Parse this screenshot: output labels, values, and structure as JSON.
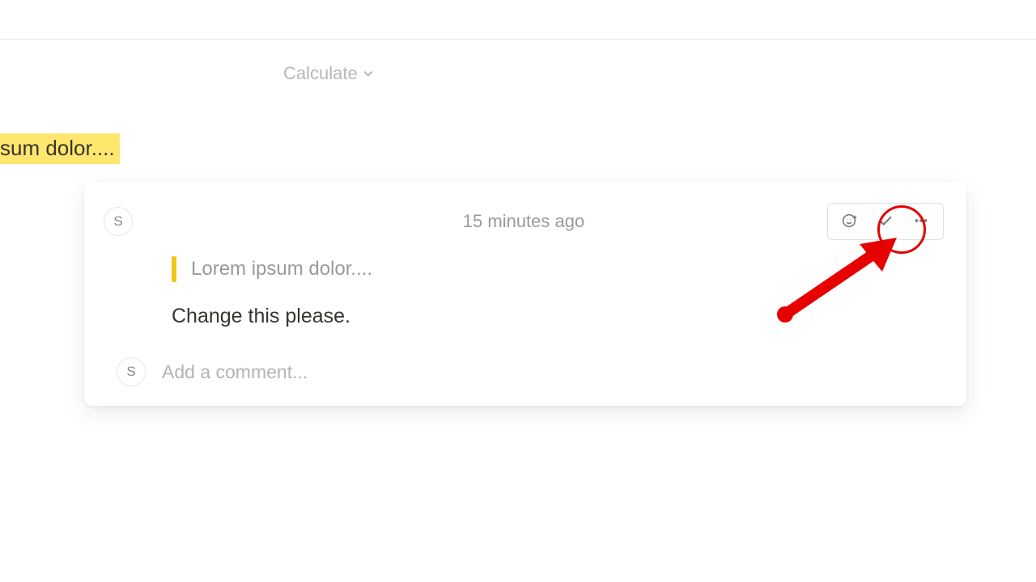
{
  "toolbar": {
    "calculate_label": "Calculate"
  },
  "document": {
    "highlight_fragment": "sum dolor...."
  },
  "comment": {
    "avatar_initial": "S",
    "timestamp": "15 minutes ago",
    "quoted_text": "Lorem ipsum dolor....",
    "body": "Change this please."
  },
  "reply": {
    "avatar_initial": "S",
    "placeholder": "Add a comment..."
  },
  "colors": {
    "highlight": "#ffe66d",
    "annotation": "#e60000"
  }
}
